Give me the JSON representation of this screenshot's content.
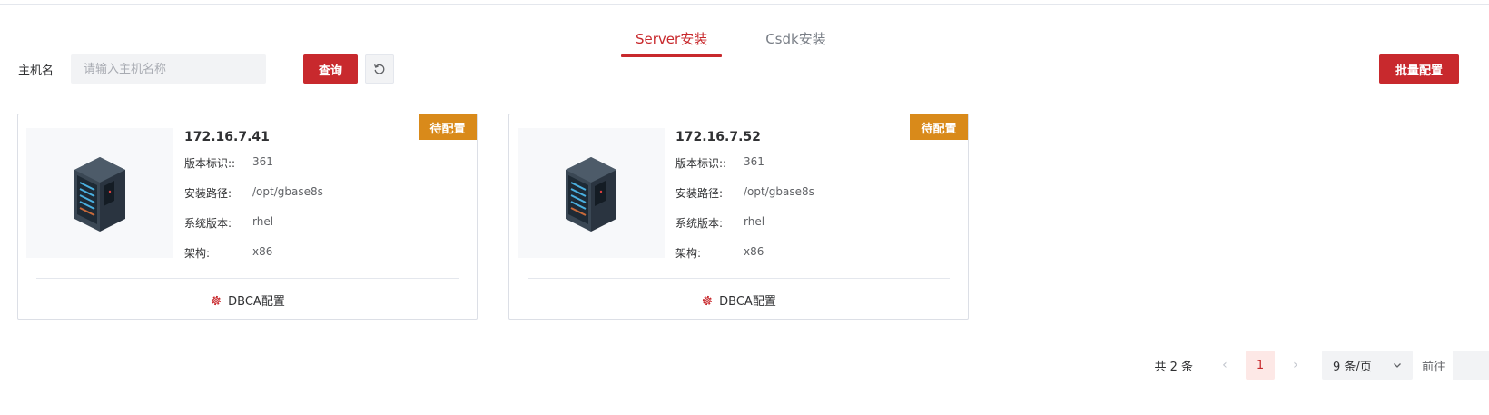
{
  "tabs": [
    {
      "label": "Server安装",
      "active": true
    },
    {
      "label": "Csdk安装",
      "active": false
    }
  ],
  "filter": {
    "label": "主机名",
    "placeholder": "请输入主机名称",
    "query_label": "查询",
    "reset_icon": "refresh-icon"
  },
  "batch_label": "批量配置",
  "cards": [
    {
      "ip": "172.16.7.41",
      "status": "待配置",
      "rows": [
        {
          "key": "版本标识::",
          "value": "361"
        },
        {
          "key": "安装路径:",
          "value": "/opt/gbase8s"
        },
        {
          "key": "系统版本:",
          "value": "rhel"
        },
        {
          "key": "架构:",
          "value": "x86"
        }
      ],
      "action_label": "DBCA配置"
    },
    {
      "ip": "172.16.7.52",
      "status": "待配置",
      "rows": [
        {
          "key": "版本标识::",
          "value": "361"
        },
        {
          "key": "安装路径:",
          "value": "/opt/gbase8s"
        },
        {
          "key": "系统版本:",
          "value": "rhel"
        },
        {
          "key": "架构:",
          "value": "x86"
        }
      ],
      "action_label": "DBCA配置"
    }
  ],
  "pagination": {
    "total": "共 2 条",
    "current_page": "1",
    "page_size": "9 条/页",
    "goto_label": "前往"
  },
  "colors": {
    "accent": "#c8292d",
    "badge": "#d98a1a"
  }
}
